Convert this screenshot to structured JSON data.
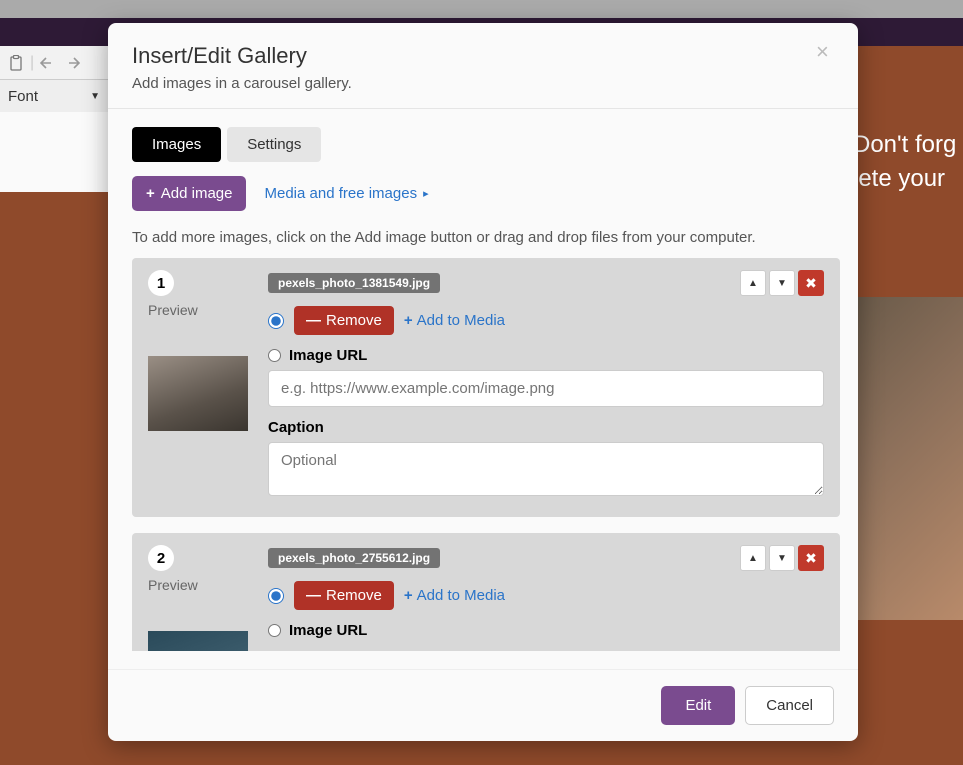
{
  "backdrop": {
    "font_label": "Font",
    "right_line1": "Don't forg",
    "right_line2": "lete your "
  },
  "modal": {
    "title": "Insert/Edit Gallery",
    "subtitle": "Add images in a carousel gallery.",
    "tabs": {
      "images": "Images",
      "settings": "Settings"
    },
    "add_image": "Add image",
    "media_link": "Media and free images",
    "help_text": "To add more images, click on the Add image button or drag and drop files from your computer.",
    "preview_label": "Preview",
    "remove_label": "Remove",
    "add_to_media": "Add to Media",
    "image_url_label": "Image URL",
    "image_url_placeholder": "e.g. https://www.example.com/image.png",
    "caption_label": "Caption",
    "caption_placeholder": "Optional",
    "footer": {
      "edit": "Edit",
      "cancel": "Cancel"
    }
  },
  "items": [
    {
      "num": "1",
      "filename": "pexels_photo_1381549.jpg"
    },
    {
      "num": "2",
      "filename": "pexels_photo_2755612.jpg"
    }
  ]
}
